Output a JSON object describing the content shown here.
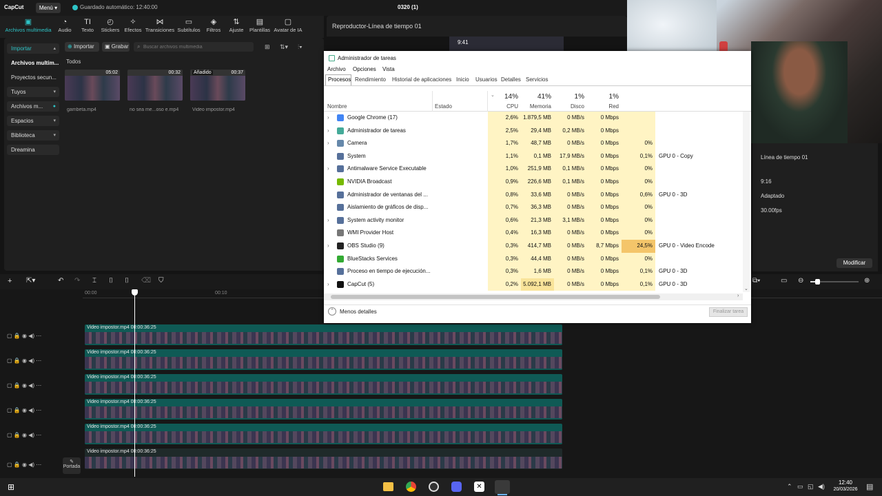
{
  "app": {
    "logo": "CapCut",
    "menu": "Menú",
    "autosave": "Guardado automático: 12:40:00",
    "project": "0320 (1)"
  },
  "tools": [
    "Archivos multimedia",
    "Audio",
    "Texto",
    "Stickers",
    "Efectos",
    "Transiciones",
    "Subtítulos",
    "Filtros",
    "Ajuste",
    "Plantillas",
    "Avatar de IA"
  ],
  "sidebar": [
    {
      "label": "Importar"
    },
    {
      "label": "Archivos multim..."
    },
    {
      "label": "Proyectos secun..."
    },
    {
      "label": "Tuyos"
    },
    {
      "label": "Archivos m..."
    },
    {
      "label": "Espacios"
    },
    {
      "label": "Biblioteca"
    },
    {
      "label": "Dreamina"
    }
  ],
  "media_toolbar": {
    "import": "Importar",
    "record": "Grabar",
    "search_placeholder": "Buscar archivos multimedia",
    "section": "Todos"
  },
  "media": [
    {
      "name": "gambeta.mp4",
      "duration": "05:02",
      "tag": ""
    },
    {
      "name": "no sea me...oso e.mp4",
      "duration": "00:32",
      "tag": ""
    },
    {
      "name": "Video impostor.mp4",
      "duration": "00:37",
      "tag": "Añadido"
    }
  ],
  "player": {
    "title": "Reproductor-Línea de tiempo 01",
    "time": "9:41"
  },
  "details": {
    "name": "Línea de tiempo 01",
    "ratio": "9:16",
    "mode": "Adaptado",
    "fps": "30.00fps",
    "modify": "Modificar"
  },
  "timeline": {
    "tick0": "00:00",
    "tick1": "00:10",
    "clip": "Video impostor.mp4",
    "clip_dur": "00:00:36:25",
    "cover": "Portada",
    "tracks": 6
  },
  "taskmgr": {
    "title": "Administrador de tareas",
    "menu": [
      "Archivo",
      "Opciones",
      "Vista"
    ],
    "tabs": [
      "Procesos",
      "Rendimiento",
      "Historial de aplicaciones",
      "Inicio",
      "Usuarios",
      "Detalles",
      "Servicios"
    ],
    "headers": {
      "name": "Nombre",
      "status": "Estado",
      "cpu_pct": "14%",
      "cpu": "CPU",
      "mem_pct": "41%",
      "mem": "Memoria",
      "disk_pct": "1%",
      "disk": "Disco",
      "net_pct": "1%",
      "net": "Red"
    },
    "rows": [
      {
        "name": "Google Chrome (17)",
        "cpu": "2,6%",
        "mem": "1.879,5 MB",
        "disk": "0 MB/s",
        "net": "0 Mbps",
        "gpu": "",
        "engine": "",
        "icon": "chrome-icon",
        "expand": true
      },
      {
        "name": "Administrador de tareas",
        "cpu": "2,5%",
        "mem": "29,4 MB",
        "disk": "0,2 MB/s",
        "net": "0 Mbps",
        "gpu": "",
        "engine": "",
        "icon": "taskmgr-icon",
        "expand": true
      },
      {
        "name": "Camera",
        "cpu": "1,7%",
        "mem": "48,7 MB",
        "disk": "0 MB/s",
        "net": "0 Mbps",
        "gpu": "0%",
        "engine": "",
        "icon": "camera-icon",
        "expand": true
      },
      {
        "name": "System",
        "cpu": "1,1%",
        "mem": "0,1 MB",
        "disk": "17,9 MB/s",
        "net": "0 Mbps",
        "gpu": "0,1%",
        "engine": "GPU 0 - Copy",
        "icon": "system-icon",
        "expand": false
      },
      {
        "name": "Antimalware Service Executable",
        "cpu": "1,0%",
        "mem": "251,9 MB",
        "disk": "0,1 MB/s",
        "net": "0 Mbps",
        "gpu": "0%",
        "engine": "",
        "icon": "system-icon",
        "expand": true
      },
      {
        "name": "NVIDIA Broadcast",
        "cpu": "0,9%",
        "mem": "226,6 MB",
        "disk": "0,1 MB/s",
        "net": "0 Mbps",
        "gpu": "0%",
        "engine": "",
        "icon": "nvidia-icon",
        "expand": false
      },
      {
        "name": "Administrador de ventanas del ...",
        "cpu": "0,8%",
        "mem": "33,6 MB",
        "disk": "0 MB/s",
        "net": "0 Mbps",
        "gpu": "0,6%",
        "engine": "GPU 0 - 3D",
        "icon": "system-icon",
        "expand": false
      },
      {
        "name": "Aislamiento de gráficos de disp...",
        "cpu": "0,7%",
        "mem": "36,3 MB",
        "disk": "0 MB/s",
        "net": "0 Mbps",
        "gpu": "0%",
        "engine": "",
        "icon": "system-icon",
        "expand": false
      },
      {
        "name": "System activity monitor",
        "cpu": "0,6%",
        "mem": "21,3 MB",
        "disk": "3,1 MB/s",
        "net": "0 Mbps",
        "gpu": "0%",
        "engine": "",
        "icon": "system-icon",
        "expand": true
      },
      {
        "name": "WMI Provider Host",
        "cpu": "0,4%",
        "mem": "16,3 MB",
        "disk": "0 MB/s",
        "net": "0 Mbps",
        "gpu": "0%",
        "engine": "",
        "icon": "wmi-icon",
        "expand": false
      },
      {
        "name": "OBS Studio (9)",
        "cpu": "0,3%",
        "mem": "414,7 MB",
        "disk": "0 MB/s",
        "net": "8,7 Mbps",
        "gpu": "24,5%",
        "engine": "GPU 0 - Video Encode",
        "icon": "obs-icon",
        "expand": true
      },
      {
        "name": "BlueStacks Services",
        "cpu": "0,3%",
        "mem": "44,4 MB",
        "disk": "0 MB/s",
        "net": "0 Mbps",
        "gpu": "0%",
        "engine": "",
        "icon": "bluestacks-icon",
        "expand": false
      },
      {
        "name": "Proceso en tiempo de ejecución...",
        "cpu": "0,3%",
        "mem": "1,6 MB",
        "disk": "0 MB/s",
        "net": "0 Mbps",
        "gpu": "0,1%",
        "engine": "GPU 0 - 3D",
        "icon": "system-icon",
        "expand": false
      },
      {
        "name": "CapCut (5)",
        "cpu": "0,2%",
        "mem": "5.092,1 MB",
        "disk": "0 MB/s",
        "net": "0 Mbps",
        "gpu": "0,1%",
        "engine": "GPU 0 - 3D",
        "icon": "capcut-icon",
        "expand": true
      }
    ],
    "less": "Menos detalles",
    "end_task": "Finalizar tarea"
  },
  "clock": {
    "time": "12:40",
    "date": "20/03/2026"
  }
}
